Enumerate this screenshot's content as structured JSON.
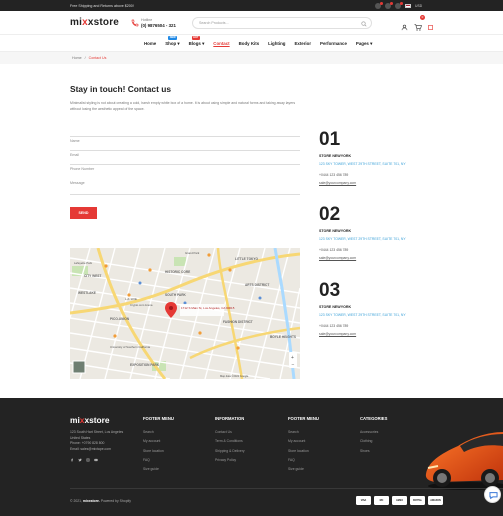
{
  "topbar": {
    "promo": "Free Shipping and Returns above $200!",
    "currency": "USD",
    "language_flag": "us-flag-icon",
    "icons": [
      "user-circle-icon",
      "wishlist-icon",
      "compare-icon"
    ]
  },
  "header": {
    "logo_prefix": "mi",
    "logo_x": "x",
    "logo_suffix": "xstore",
    "hotline_label": "Hotline",
    "hotline_number": "(0) 9876504 - 321",
    "search_placeholder": "Search Products...",
    "cart_count": "0"
  },
  "nav": {
    "items": [
      {
        "label": "Home"
      },
      {
        "label": "Shop",
        "badge": "NEW",
        "badge_color": "#1e88e5",
        "dropdown": "▾"
      },
      {
        "label": "Blogs",
        "badge": "HOT",
        "badge_color": "#e53935",
        "dropdown": "▾"
      },
      {
        "label": "Contact"
      },
      {
        "label": "Body Kits"
      },
      {
        "label": "Lighting"
      },
      {
        "label": "Exterior"
      },
      {
        "label": "Performance"
      },
      {
        "label": "Pages",
        "dropdown": "▾"
      }
    ]
  },
  "breadcrumb": {
    "home": "Home",
    "separator": "/",
    "current": "Contact Us"
  },
  "contact": {
    "title": "Stay in touch! Contact us",
    "intro": "Minimalist styling is not about creating a cold, harsh empty white box of a home. It is about using simple and natural forms and taking away layers without losing the aesthetic appeal of the space.",
    "fields": {
      "name": "Name",
      "email": "Email",
      "phone": "Phone Number",
      "message": "Message"
    },
    "send": "SEND"
  },
  "stores": [
    {
      "num": "01",
      "name": "STORE NEWYORK",
      "address": "123 SKY TOWER, WEST 29TH STREET, SUITE 701, NY",
      "phone": "+0444 123 456 789",
      "email": "sale@yourcompany.com"
    },
    {
      "num": "02",
      "name": "STORE NEWYORK",
      "address": "123 SKY TOWER, WEST 29TH STREET, SUITE 701, NY",
      "phone": "+0444 123 456 789",
      "email": "sale@yourcompany.com"
    },
    {
      "num": "03",
      "name": "STORE NEWYORK",
      "address": "123 SKY TOWER, WEST 29TH STREET, SUITE 701, NY",
      "phone": "+0444 123 456 789",
      "email": "sale@yourcompany.com"
    }
  ],
  "map": {
    "pin_label": "1712 S Main St, Los Angeles, CA 90015",
    "labels": {
      "city_west": "CITY WEST",
      "historic_core": "HISTORIC CORE",
      "south_park": "SOUTH PARK",
      "fashion_district": "FASHION DISTRICT",
      "little_tokyo": "LITTLE TOKYO",
      "arts_district": "ARTS DISTRICT",
      "westlake": "WESTLAKE",
      "pico_union": "PICO-UNION",
      "exposition_park": "EXPOSITION PARK",
      "lafayette_park": "Lafayette Park",
      "crypto": "Crypto.com Arena",
      "grand_park": "Grand Park",
      "usc": "University of Southern California",
      "la_live": "L.A. LIVE",
      "boyle": "BOYLE HEIGHTS"
    },
    "footer_text": "Map data ©2021 Google"
  },
  "footer": {
    "logo_prefix": "mi",
    "logo_x": "x",
    "logo_suffix": "xstore",
    "info": [
      "123 South Hart Street, Los Angeles",
      "United States",
      "Phone: +0790 828 800",
      "Email: sales@mixtape.com"
    ],
    "social": [
      "facebook-icon",
      "twitter-icon",
      "instagram-icon",
      "youtube-icon"
    ],
    "columns": [
      {
        "title": "FOOTER MENU",
        "links": [
          "Search",
          "My account",
          "Store location",
          "FAQ",
          "Size guide"
        ]
      },
      {
        "title": "INFORMATION",
        "links": [
          "Contact Us",
          "Term & Conditions",
          "Shipping & Delivery",
          "Privacy Policy"
        ]
      },
      {
        "title": "FOOTER MENU",
        "links": [
          "Search",
          "My account",
          "Store location",
          "FAQ",
          "Size guide"
        ]
      },
      {
        "title": "CATEGORIES",
        "links": [
          "Accessories",
          "Clothing",
          "Shoes"
        ]
      }
    ],
    "copyright_prefix": "© 2021,",
    "copyright_brand": "mixxstore.",
    "copyright_suffix": "Powered by Shopify",
    "payments": [
      "VISA",
      "MC",
      "AMEX",
      "PAYPAL",
      "AMAZON"
    ]
  },
  "colors": {
    "accent": "#e53935",
    "link_blue": "#3aa0d8",
    "dark": "#232323"
  }
}
